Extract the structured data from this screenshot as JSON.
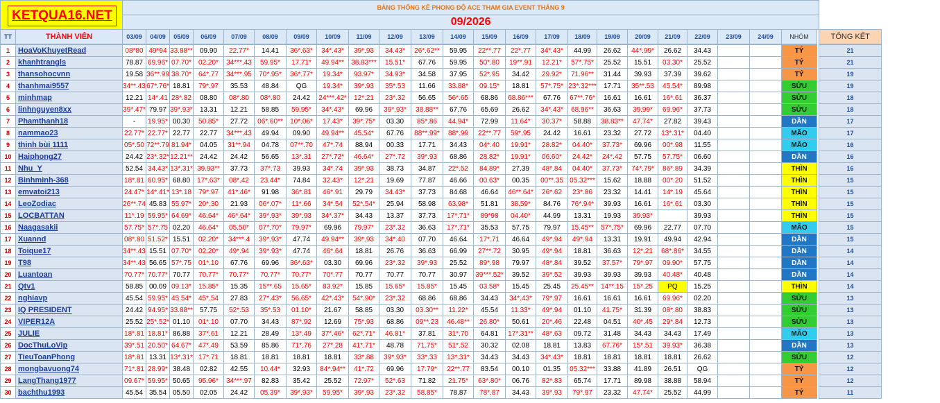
{
  "logo": "KETQUA16.NET",
  "title": "BẢNG THỐNG KÊ PHONG ĐỘ ACE THAM GIA EVENT THÁNG 9",
  "month": "09/2026",
  "columns": {
    "tt": "TT",
    "member": "THÀNH VIÊN",
    "dates": [
      "03/09",
      "04/09",
      "05/09",
      "06/09",
      "07/09",
      "08/09",
      "09/09",
      "10/09",
      "11/09",
      "12/09",
      "13/09",
      "14/09",
      "15/09",
      "16/09",
      "17/09",
      "18/09",
      "19/09",
      "20/09",
      "21/09",
      "22/09",
      "23/09",
      "24/09"
    ],
    "group": "NHÓM",
    "total": "TỔNG KẾT"
  },
  "rows": [
    {
      "tt": "1",
      "name": "HoaVoKhuyetRead",
      "scores": [
        "08*80",
        "49*94",
        "33.88**",
        "09.90",
        "22.77*",
        "14.41",
        "36*.63*",
        "34*.43*",
        "39*.93",
        "34.43*",
        "26*.62**",
        "59.95",
        "22**.77",
        "22*.77",
        "34*.43*",
        "44.99",
        "26.62",
        "44*.99*",
        "26.62",
        "34.43",
        "",
        ""
      ],
      "group": "TÝ",
      "total": "21"
    },
    {
      "tt": "2",
      "name": "khanhtrangls",
      "scores": [
        "78.87",
        "69.96*",
        "07.70*",
        "02.20*",
        "34***.43",
        "59.95*",
        "17.71*",
        "49.94**",
        "38.83***",
        "15.51*",
        "67.76",
        "59.95",
        "50*.80",
        "19**.91",
        "12.21*",
        "57*.75*",
        "25.52",
        "15.51",
        "03.30*",
        "25.52",
        "",
        ""
      ],
      "group": "TÝ",
      "total": "21"
    },
    {
      "tt": "3",
      "name": "thansohocvnn",
      "scores": [
        "19.58",
        "36**.99",
        "38.70*",
        "64*.77",
        "34***.95",
        "70*.95*",
        "36*.77*",
        "19.34*",
        "93.97*",
        "34.93*",
        "34.58",
        "37.95",
        "52*.95",
        "34.42",
        "29.92*",
        "71.96**",
        "31.44",
        "39.93",
        "37.39",
        "39.62",
        "",
        ""
      ],
      "group": "TÝ",
      "total": "19"
    },
    {
      "tt": "4",
      "name": "thanhmai9557",
      "scores": [
        "34**.43*",
        "67*.76*",
        "18.81",
        "79*.97",
        "35.53",
        "48.84",
        "QG",
        "19.34*",
        "39*.93",
        "35*.53",
        "11.66",
        "33.88*",
        "09.15*",
        "18.81",
        "57*.75*",
        "23*.32***",
        "17.71",
        "35**.53",
        "45.54*",
        "89.98",
        "",
        ""
      ],
      "group": "SỬU",
      "total": "19"
    },
    {
      "tt": "5",
      "name": "minhmap",
      "scores": [
        "12.21",
        "14*.41",
        "28*.82",
        "08.80",
        "08*.80",
        "08*.80",
        "24.42",
        "24***.42*",
        "12*.21",
        "23*.32",
        "56.65",
        "56*.65",
        "68.86",
        "68.86***",
        "67.76",
        "67**.76*",
        "16.61",
        "16.61",
        "16*.61",
        "36.37",
        "",
        ""
      ],
      "group": "SỬU",
      "total": "18"
    },
    {
      "tt": "6",
      "name": "linhnguyen8xx",
      "scores": [
        "39*.47*",
        "79.97",
        "39*.93**",
        "13.31",
        "12.21",
        "58.85",
        "59.95*",
        "34*.43*",
        "69.96",
        "39*.93*",
        "38.88**",
        "67.76",
        "65.69",
        "26.62",
        "34*.43*",
        "68.96**",
        "36.63",
        "39.99*",
        "69.96*",
        "37.73",
        "",
        ""
      ],
      "group": "SỬU",
      "total": "18"
    },
    {
      "tt": "7",
      "name": "Phamthanh18",
      "scores": [
        "-",
        "19.95*",
        "00.30",
        "50.85*",
        "27.72",
        "06*.60**",
        "10*.06*",
        "17.43*",
        "39*.75*",
        "03.30",
        "85*.86",
        "44.94*",
        "72.99",
        "11.64*",
        "30.37*",
        "58.88",
        "38.83**",
        "47.74*",
        "27.82",
        "39.43",
        "",
        ""
      ],
      "group": "DẦN",
      "total": "17"
    },
    {
      "tt": "8",
      "name": "nammao23",
      "scores": [
        "22.77*",
        "22.77*",
        "22.77",
        "22.77",
        "34***.43",
        "49.94",
        "09.90",
        "49.94**",
        "45.54*",
        "67.76",
        "88**.99*",
        "88*.99",
        "22**.77",
        "59*.95",
        "24.42",
        "16.61",
        "23.32",
        "27.72",
        "13*.31*",
        "04.40",
        "",
        ""
      ],
      "group": "MÃO",
      "total": "17"
    },
    {
      "tt": "9",
      "name": "thinh bùi 1111",
      "scores": [
        "05*.50",
        "72**.79",
        "81.94*",
        "04.05",
        "31**.94",
        "04.78",
        "07**.70",
        "47*.74",
        "88.94",
        "00.33",
        "17.71",
        "34.43",
        "04*.40",
        "19.91*",
        "28.82*",
        "04.40*",
        "37.73*",
        "69.96",
        "00*.98",
        "11.55",
        "",
        ""
      ],
      "group": "MÃO",
      "total": "16"
    },
    {
      "tt": "10",
      "name": "Haiphong27",
      "scores": [
        "24.42",
        "23*.32*",
        "12.21**",
        "24.42",
        "24.42",
        "56.65",
        "13*.31",
        "27*.72*",
        "46.64*",
        "27*.72",
        "39*.93",
        "68.86",
        "28.82*",
        "19.91*",
        "06.60*",
        "24.42*",
        "24*.42",
        "57.75",
        "57.75*",
        "06.60",
        "",
        ""
      ],
      "group": "DẦN",
      "total": "16"
    },
    {
      "tt": "11",
      "name": "Nhu_Y",
      "scores": [
        "52.54",
        "34.43*",
        "13*.31*",
        "39.93**",
        "37.73",
        "37*.73",
        "39.93",
        "34*.74",
        "39*.93",
        "38.73",
        "34.87",
        "22*.52",
        "84.89*",
        "27.39",
        "48*.84",
        "04.40*",
        "37.73*",
        "74*.79*",
        "86*.89",
        "34.39",
        "",
        ""
      ],
      "group": "THÌN",
      "total": "16"
    },
    {
      "tt": "12",
      "name": "Binhminh-368",
      "scores": [
        "18*.81",
        "60.95*",
        "68.80",
        "17*.63*",
        "08*.42",
        "23.44*",
        "74.84",
        "32.43*",
        "12*.21",
        "19.69",
        "77.87",
        "46.66",
        "00.63*",
        "00.35",
        "00**.35",
        "05.32***",
        "15.62",
        "18.88",
        "00*.20",
        "51.52",
        "",
        ""
      ],
      "group": "THÌN",
      "total": "15"
    },
    {
      "tt": "13",
      "name": "emvatoi213",
      "scores": [
        "24.47*",
        "14*.41*",
        "13*.18",
        "79*.97",
        "41*.46*",
        "91.98",
        "36*.81",
        "46*.91",
        "29.79",
        "34.43*",
        "37.73",
        "84.68",
        "46.64",
        "46**.64*",
        "26*.62",
        "23*.86",
        "23.32",
        "14.41",
        "14*.19",
        "45.64",
        "",
        ""
      ],
      "group": "THÌN",
      "total": "15"
    },
    {
      "tt": "14",
      "name": "LeoZodiac",
      "scores": [
        "26**.74",
        "45.83",
        "55.97*",
        "20*.30",
        "21.93",
        "06*.07*",
        "11*.66",
        "34*.54",
        "52*.54*",
        "25.94",
        "58.98",
        "63.98*",
        "51.81",
        "38.59*",
        "84.76",
        "76*.94*",
        "39.93",
        "16.61",
        "16*.61",
        "03.30",
        "",
        ""
      ],
      "group": "THÌN",
      "total": "15"
    },
    {
      "tt": "15",
      "name": "LOCBATTAN",
      "scores": [
        "11*.19",
        "59.95*",
        "64.69*",
        "46.64*",
        "46*.64*",
        "39*.93*",
        "39*.93",
        "34*.37*",
        "34.43",
        "13.37",
        "37.73",
        "17*.71*",
        "89*98",
        "04.40*",
        "44.99",
        "13.31",
        "19.93",
        "39.93*",
        "",
        "39.93",
        "",
        ""
      ],
      "group": "THÌN",
      "total": "15"
    },
    {
      "tt": "16",
      "name": "Naagasakii",
      "scores": [
        "57.75*",
        "57*.75",
        "02.20",
        "46.64*",
        "05.50*",
        "07*.70*",
        "79.97*",
        "69.96",
        "79.97*",
        "23*.32",
        "36.63",
        "17*.71*",
        "35.53",
        "57.75",
        "79.97",
        "15.45**",
        "57*.75*",
        "69.96",
        "22.77",
        "07.70",
        "",
        ""
      ],
      "group": "MÃO",
      "total": "15"
    },
    {
      "tt": "17",
      "name": "Xuannd",
      "scores": [
        "08*.80",
        "51.52*",
        "15.51",
        "02.20*",
        "34***.4",
        "39*.93*",
        "47.74",
        "49.94**",
        "39*.93",
        "34*.40",
        "07.70",
        "46.64",
        "17*.71",
        "46.64",
        "49*.94",
        "49*.94",
        "13.31",
        "19.91",
        "49.94",
        "42.94",
        "",
        ""
      ],
      "group": "DẦN",
      "total": "15"
    },
    {
      "tt": "18",
      "name": "Toique17",
      "scores": [
        "34**.43*",
        "15.51",
        "07.70*",
        "02.20*",
        "49*.94",
        "39*.93*",
        "47.74",
        "46*.64",
        "18.81",
        "26.76",
        "36.63",
        "66.99",
        "27**.72",
        "30.95",
        "49*.94",
        "18.81",
        "36.63",
        "12*.21",
        "68*.86*",
        "34.55",
        "",
        ""
      ],
      "group": "DẦN",
      "total": "14"
    },
    {
      "tt": "19",
      "name": "T98",
      "scores": [
        "34**.43*",
        "56.65",
        "57*.75",
        "01*.10",
        "67.76",
        "69.96",
        "36*.63*",
        "03.30",
        "69.96",
        "23*.32",
        "39*.93",
        "25.52",
        "89*.98",
        "79.97",
        "48*.84",
        "39.52",
        "37.57*",
        "79*.97",
        "09.90*",
        "57.75",
        "",
        ""
      ],
      "group": "DẦN",
      "total": "14"
    },
    {
      "tt": "20",
      "name": "Luantoan",
      "scores": [
        "70.77*",
        "70.77*",
        "70.77",
        "70.77*",
        "70.77*",
        "70.77*",
        "70.77*",
        "70*.77",
        "70.77",
        "70.77",
        "70.77",
        "30.97",
        "39***.52*",
        "39.52",
        "39*.52",
        "39.93",
        "39.93",
        "39.93",
        "40.48*",
        "40.48",
        "",
        ""
      ],
      "group": "DẦN",
      "total": "14"
    },
    {
      "tt": "21",
      "name": "Qtv1",
      "scores": [
        "58.85",
        "00.09",
        "09.13*",
        "15.85*",
        "15.35",
        "15**.65",
        "15.65*",
        "83.92*",
        "15.85",
        "15.65*",
        "15.85*",
        "15.45",
        "03.58*",
        "15.45",
        "25.45",
        "25.45**",
        "14**.15",
        "15*.25",
        "PQ",
        "15.25",
        "",
        ""
      ],
      "group": "THÌN",
      "total": "14"
    },
    {
      "tt": "22",
      "name": "nghiavp",
      "scores": [
        "45.54",
        "59.95*",
        "45.54*",
        "45*.54",
        "27.83",
        "27*.43*",
        "56.65*",
        "42*.43*",
        "54*.90*",
        "23*.32",
        "68.86",
        "68.86",
        "34.43",
        "34*.43*",
        "79*.97",
        "16.61",
        "16.61",
        "16.61",
        "69.96*",
        "02.20",
        "",
        ""
      ],
      "group": "SỬU",
      "total": "13"
    },
    {
      "tt": "23",
      "name": "IQ PRESIDENT",
      "scores": [
        "24.42",
        "94.95*",
        "33.88**",
        "57.75",
        "52*.53",
        "35*.53",
        "01.10*",
        "21.67",
        "58.85",
        "03.30",
        "03.30**",
        "11.22*",
        "45.54",
        "11.33*",
        "49*.94",
        "01.10",
        "41.75*",
        "31.39",
        "08*.80",
        "38.83",
        "",
        ""
      ],
      "group": "SỬU",
      "total": "13"
    },
    {
      "tt": "24",
      "name": "VIPER12A",
      "scores": [
        "25.52",
        "25*.52*",
        "01.10",
        "01*.10",
        "07.70",
        "34.43",
        "87*.92",
        "12.69",
        "75*.93",
        "68.86",
        "09**.23",
        "46.48**",
        "26.80*",
        "50.61",
        "20*.46",
        "22.48",
        "04.51",
        "40*.45",
        "29*.84",
        "12.73",
        "",
        ""
      ],
      "group": "SỬU",
      "total": "13"
    },
    {
      "tt": "25",
      "name": "JULIE",
      "scores": [
        "18*.81",
        "18.81*",
        "86.88",
        "37*.61",
        "12.21",
        "28.49",
        "13*.49",
        "37*.46*",
        "62*.71*",
        "46.81*",
        "37.81",
        "31*.70",
        "64.81",
        "17*.31**",
        "48*.63",
        "09.72",
        "31.48",
        "34.43",
        "34.43",
        "17.49",
        "",
        ""
      ],
      "group": "MÃO",
      "total": "13"
    },
    {
      "tt": "26",
      "name": "DocThuLoVip",
      "scores": [
        "39*.51",
        "20.50*",
        "64.67*",
        "47*.49",
        "53.59",
        "85.86",
        "71*.76",
        "27*.28",
        "41*.71*",
        "48.78",
        "71.75*",
        "51*.52",
        "30.32",
        "02.08",
        "18.81",
        "13.83",
        "67.76*",
        "15*.51",
        "39.93*",
        "36.38",
        "",
        ""
      ],
      "group": "DẦN",
      "total": "13"
    },
    {
      "tt": "27",
      "name": "TieuToanPhong",
      "scores": [
        "18*.81",
        "13.31",
        "13*.31*",
        "17*.71",
        "18.81",
        "18.81",
        "18.81",
        "18.81",
        "33*.88",
        "39*.93*",
        "33*.33",
        "13*.31*",
        "34.43",
        "34.43",
        "34*.43*",
        "18.81",
        "18.81",
        "18.81",
        "18.81",
        "26.62",
        "",
        ""
      ],
      "group": "SỬU",
      "total": "12"
    },
    {
      "tt": "28",
      "name": "mongbavuong74",
      "scores": [
        "71*.81",
        "28.99*",
        "38.48",
        "02.82",
        "42.55",
        "10.44*",
        "32.93",
        "84*.94**",
        "41*.72",
        "69.96",
        "17.79*",
        "22**.77",
        "83.54",
        "00.10",
        "01.35",
        "05.32***",
        "33.88",
        "41.89",
        "26.51",
        "QG",
        "",
        ""
      ],
      "group": "TÝ",
      "total": "12"
    },
    {
      "tt": "29",
      "name": "LangThang1977",
      "scores": [
        "09.67*",
        "59.95*",
        "50.65",
        "95.96*",
        "34***.97",
        "82.83",
        "35.42",
        "25.52",
        "72.97*",
        "52*.63",
        "71.82",
        "21.75*",
        "63*.80*",
        "06.76",
        "82*.83",
        "65.74",
        "17.71",
        "89.98",
        "38.88",
        "58.94",
        "",
        ""
      ],
      "group": "TÝ",
      "total": "12"
    },
    {
      "tt": "30",
      "name": "bachthu1993",
      "scores": [
        "45.54",
        "35.54",
        "05.50",
        "02.05",
        "24.42",
        "05.39*",
        "39*.93*",
        "59.95*",
        "39*.93",
        "23*.32",
        "58.85*",
        "78.87",
        "78*.87",
        "34.43",
        "39*.93",
        "79*.97",
        "23.32",
        "47.74*",
        "25.52",
        "44.99",
        "",
        ""
      ],
      "group": "TÝ",
      "total": "11"
    }
  ]
}
